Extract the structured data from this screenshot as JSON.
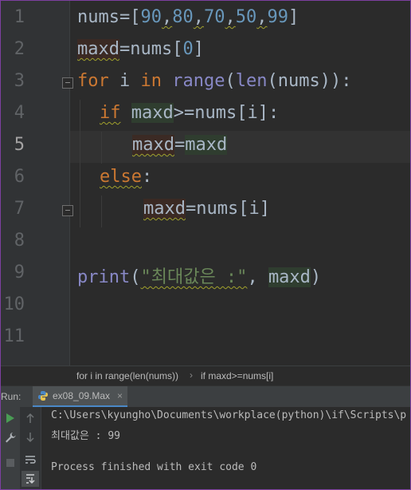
{
  "editor": {
    "line_numbers": [
      "1",
      "2",
      "3",
      "4",
      "5",
      "6",
      "7",
      "8",
      "9",
      "10",
      "11"
    ],
    "current_line": "5",
    "lines": {
      "l1": {
        "a": "nums",
        "b": "=[",
        "n1": "90",
        "c1": ",",
        "n2": "80",
        "c2": ",",
        "n3": "70",
        "c3": ",",
        "n4": "50",
        "c4": ",",
        "n5": "99",
        "d": "]"
      },
      "l2": {
        "a": "maxd",
        "b": "=nums[",
        "n": "0",
        "c": "]"
      },
      "l3": {
        "kw1": "for",
        "sp1": " i ",
        "kw2": "in",
        "sp2": " ",
        "f1": "range",
        "p1": "(",
        "f2": "len",
        "p2": "(nums)):"
      },
      "l4": {
        "kw": "if",
        "sp": " ",
        "v": "maxd",
        ">": ">=nums[i]:"
      },
      "l5": {
        "v1": "maxd",
        "eq": "=",
        "v2": "maxd"
      },
      "l6": {
        "kw": "else",
        "c": ":"
      },
      "l7": {
        "v": "maxd",
        "rest": "=nums[i]"
      },
      "l9": {
        "f": "print",
        "p": "(",
        "s": "\"최대값은 :\"",
        "c": ", ",
        "v": "maxd",
        "e": ")"
      }
    }
  },
  "breadcrumb": {
    "item1": "for i in range(len(nums))",
    "separator": "›",
    "item2": "if maxd>=nums[i]"
  },
  "run_panel": {
    "label": "Run:",
    "tab_label": "ex08_09.Max",
    "tab_close": "×",
    "icons": [
      "run-icon",
      "up-arrow-icon",
      "wrench-icon",
      "down-arrow-icon",
      "stop-icon",
      "soft-wrap-icon",
      "scroll-to-end-icon"
    ],
    "output": [
      "C:\\Users\\kyungho\\Documents\\workplace(python)\\if\\Scripts\\p",
      "최대값은 : 99",
      "",
      "Process finished with exit code 0"
    ]
  },
  "colors": {
    "keyword": "#cc7832",
    "number": "#6897bb",
    "builtin": "#8888c6",
    "string": "#6a8759",
    "run_green": "#499c54",
    "frame_border": "#7d3fa0"
  }
}
